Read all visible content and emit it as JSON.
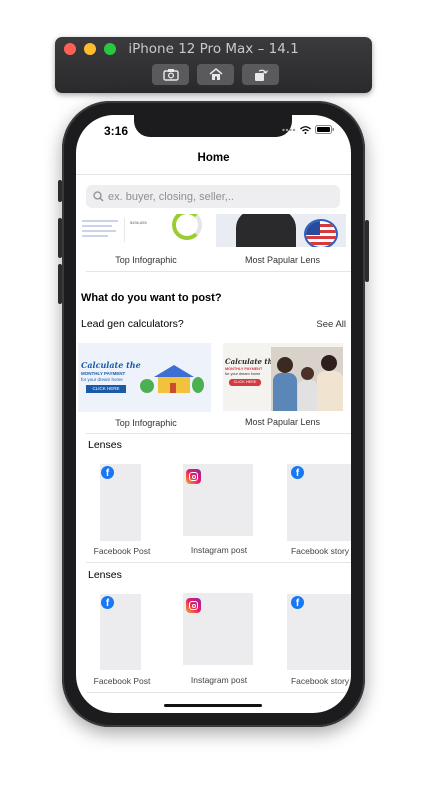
{
  "simulator": {
    "title": "iPhone 12 Pro Max – 14.1",
    "buttons": [
      "screenshot",
      "home",
      "rotate"
    ]
  },
  "status_bar": {
    "time": "3:16"
  },
  "nav": {
    "title": "Home"
  },
  "search": {
    "placeholder": "ex. buyer, closing, seller,.."
  },
  "top_banners": [
    {
      "caption": "Top Infographic",
      "thumb_text": "$456,855"
    },
    {
      "caption": "Most Papular Lens"
    }
  ],
  "post_section": {
    "title": "What do you want to post?"
  },
  "calculators": {
    "title": "Lead gen calculators?",
    "see_all": "See All",
    "items": [
      {
        "caption": "Top Infographic",
        "line1": "Calculate the",
        "line2": "MONTHLY PAYMENT",
        "line3": "for your dream home",
        "cta": "CLICK HERE"
      },
      {
        "caption": "Most Papular Lens",
        "line1": "Calculate the",
        "line2": "MONTHLY PAYMENT",
        "line3": "for your dream home",
        "cta": "CLICK HERE"
      }
    ]
  },
  "lens_sections": [
    {
      "title": "Lenses",
      "items": [
        {
          "label": "Facebook Post",
          "icon": "facebook-icon"
        },
        {
          "label": "Instagram post",
          "icon": "instagram-icon"
        },
        {
          "label": "Facebook story",
          "icon": "facebook-icon"
        }
      ]
    },
    {
      "title": "Lenses",
      "items": [
        {
          "label": "Facebook Post",
          "icon": "facebook-icon"
        },
        {
          "label": "Instagram post",
          "icon": "instagram-icon"
        },
        {
          "label": "Facebook story",
          "icon": "facebook-icon"
        }
      ]
    }
  ],
  "colors": {
    "facebook": "#1877f2",
    "calc_banner_blue": "#1a5aa8",
    "calc_banner_red": "#d6393f"
  }
}
